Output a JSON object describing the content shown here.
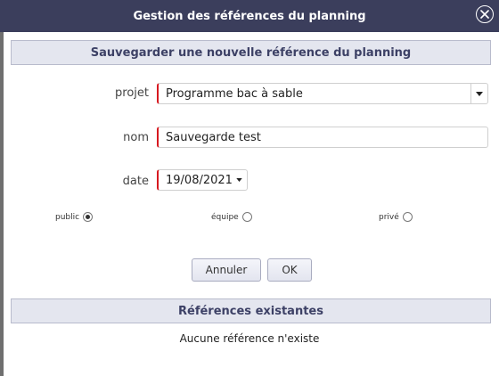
{
  "dialog": {
    "title": "Gestion des références du planning"
  },
  "save_section": {
    "header": "Sauvegarder une nouvelle référence du planning"
  },
  "form": {
    "projet_label": "projet",
    "projet_value": "Programme bac à sable",
    "nom_label": "nom",
    "nom_value": "Sauvegarde test",
    "date_label": "date",
    "date_value": "19/08/2021"
  },
  "visibility": {
    "options": [
      {
        "label": "public",
        "selected": true
      },
      {
        "label": "équipe",
        "selected": false
      },
      {
        "label": "privé",
        "selected": false
      }
    ]
  },
  "buttons": {
    "cancel": "Annuler",
    "ok": "OK"
  },
  "existing_section": {
    "header": "Références existantes",
    "empty_message": "Aucune référence n'existe"
  },
  "icons": {
    "close": "close-circle-icon",
    "dropdown": "chevron-down-icon"
  },
  "colors": {
    "titlebar": "#3b3e5c",
    "section_bg": "#e4e6ef",
    "required_border": "#d71920"
  }
}
